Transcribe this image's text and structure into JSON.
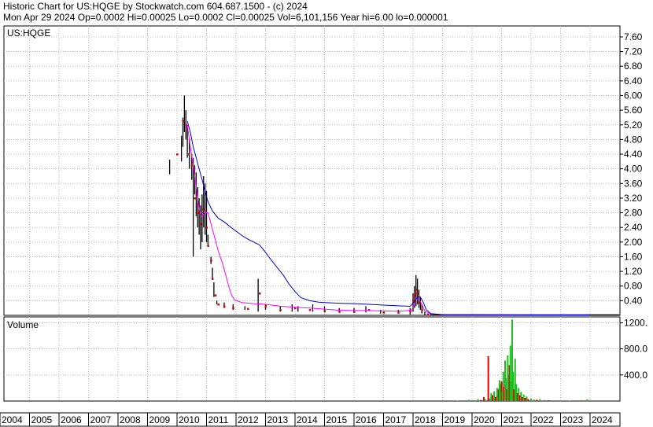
{
  "header": {
    "line1": "Historic Chart for US:HQGE by Stockwatch.com 604.687.1500 - (c) 2024",
    "line2": "Mon Apr 29 2024   Op=0.0002   Hi=0.00025   Lo=0.0002   Cl=0.00025   Vol=6,101,156   Year hi=6.00   lo=0.000001"
  },
  "chart_data": [
    {
      "type": "line",
      "title": "US:HQGE",
      "ylim": [
        0,
        7.9
      ],
      "yticks": [
        "7.60",
        "7.20",
        "6.80",
        "6.40",
        "6.00",
        "5.60",
        "5.20",
        "4.80",
        "4.40",
        "4.00",
        "3.60",
        "3.20",
        "2.80",
        "2.40",
        "2.00",
        "1.60",
        "1.20",
        "0.80",
        "0.40"
      ],
      "grid": true,
      "x_labels": [
        "2004",
        "2005",
        "2006",
        "2007",
        "2008",
        "2009",
        "2010",
        "2011",
        "2012",
        "2013",
        "2014",
        "2015",
        "2016",
        "2017",
        "2018",
        "2019",
        "2020",
        "2021",
        "2022",
        "2023",
        "2024"
      ],
      "price_range": [
        [
          2009.75,
          3.85,
          4.25
        ],
        [
          2010.15,
          4.2,
          4.9
        ],
        [
          2010.2,
          4.6,
          5.4
        ],
        [
          2010.25,
          5.0,
          6.0
        ],
        [
          2010.3,
          4.8,
          5.6
        ],
        [
          2010.35,
          4.3,
          5.2
        ],
        [
          2010.42,
          4.0,
          4.8
        ],
        [
          2010.5,
          3.7,
          4.4
        ],
        [
          2010.55,
          1.6,
          4.3
        ],
        [
          2010.6,
          3.3,
          4.1
        ],
        [
          2010.65,
          2.7,
          3.9
        ],
        [
          2010.7,
          2.4,
          3.5
        ],
        [
          2010.75,
          2.2,
          3.2
        ],
        [
          2010.8,
          1.8,
          3.0
        ],
        [
          2010.85,
          2.0,
          3.3
        ],
        [
          2010.9,
          2.4,
          3.8
        ],
        [
          2010.95,
          2.2,
          3.6
        ],
        [
          2011.0,
          2.0,
          3.4
        ],
        [
          2011.05,
          1.9,
          2.2
        ],
        [
          2011.15,
          1.4,
          1.6
        ],
        [
          2011.2,
          1.0,
          1.3
        ],
        [
          2011.25,
          0.5,
          0.9
        ],
        [
          2011.35,
          0.3,
          0.4
        ],
        [
          2011.6,
          0.2,
          0.35
        ],
        [
          2011.9,
          0.15,
          0.3
        ],
        [
          2012.3,
          0.15,
          0.25
        ],
        [
          2012.75,
          0.1,
          1.0
        ],
        [
          2013.0,
          0.15,
          0.3
        ],
        [
          2013.5,
          0.1,
          0.25
        ],
        [
          2013.9,
          0.1,
          0.3
        ],
        [
          2014.1,
          0.1,
          0.25
        ],
        [
          2014.6,
          0.1,
          0.3
        ],
        [
          2015.0,
          0.08,
          0.25
        ],
        [
          2015.5,
          0.08,
          0.2
        ],
        [
          2016.0,
          0.08,
          0.2
        ],
        [
          2016.4,
          0.08,
          0.25
        ],
        [
          2016.9,
          0.05,
          0.15
        ],
        [
          2017.5,
          0.05,
          0.15
        ],
        [
          2017.9,
          0.02,
          0.2
        ],
        [
          2018.0,
          0.1,
          0.6
        ],
        [
          2018.05,
          0.2,
          0.8
        ],
        [
          2018.1,
          0.25,
          1.1
        ],
        [
          2018.15,
          0.3,
          1.0
        ],
        [
          2018.2,
          0.2,
          0.7
        ],
        [
          2018.25,
          0.15,
          0.5
        ],
        [
          2018.3,
          0.05,
          0.3
        ],
        [
          2018.4,
          0.01,
          0.1
        ],
        [
          2018.6,
          0.005,
          0.05
        ],
        [
          2019.0,
          0.001,
          0.02
        ],
        [
          2021.0,
          0.001,
          0.01
        ],
        [
          2023.9,
          0.0002,
          0.001
        ]
      ],
      "close_points": [
        [
          2010.0,
          4.4
        ],
        [
          2010.2,
          5.3
        ],
        [
          2010.3,
          5.2
        ],
        [
          2010.4,
          4.4
        ],
        [
          2010.5,
          4.1
        ],
        [
          2010.6,
          3.2
        ],
        [
          2010.7,
          2.8
        ],
        [
          2010.8,
          2.5
        ],
        [
          2010.9,
          2.9
        ],
        [
          2011.0,
          2.4
        ],
        [
          2011.05,
          1.9
        ],
        [
          2011.15,
          1.5
        ],
        [
          2011.2,
          1.0
        ],
        [
          2011.3,
          0.55
        ],
        [
          2011.4,
          0.3
        ],
        [
          2011.6,
          0.25
        ],
        [
          2011.9,
          0.2
        ],
        [
          2012.4,
          0.18
        ],
        [
          2012.8,
          0.6
        ],
        [
          2013.0,
          0.25
        ],
        [
          2013.5,
          0.15
        ],
        [
          2014.0,
          0.2
        ],
        [
          2014.5,
          0.15
        ],
        [
          2015.0,
          0.12
        ],
        [
          2015.5,
          0.1
        ],
        [
          2016.0,
          0.1
        ],
        [
          2016.5,
          0.15
        ],
        [
          2017.0,
          0.08
        ],
        [
          2017.5,
          0.08
        ],
        [
          2017.9,
          0.12
        ],
        [
          2018.0,
          0.4
        ],
        [
          2018.05,
          0.55
        ],
        [
          2018.1,
          0.7
        ],
        [
          2018.15,
          0.6
        ],
        [
          2018.2,
          0.35
        ],
        [
          2018.3,
          0.15
        ],
        [
          2018.5,
          0.03
        ]
      ],
      "series": [
        {
          "color": "#ff00ff",
          "points": [
            [
              2010.35,
              5.2
            ],
            [
              2010.45,
              4.6
            ],
            [
              2010.55,
              4.1
            ],
            [
              2010.65,
              3.5
            ],
            [
              2010.75,
              2.9
            ],
            [
              2010.85,
              2.7
            ],
            [
              2010.95,
              2.8
            ],
            [
              2011.05,
              2.8
            ],
            [
              2011.15,
              2.5
            ],
            [
              2011.25,
              2.2
            ],
            [
              2011.4,
              1.75
            ],
            [
              2011.55,
              1.4
            ],
            [
              2011.65,
              1.1
            ],
            [
              2011.75,
              0.8
            ],
            [
              2011.85,
              0.55
            ],
            [
              2011.95,
              0.42
            ],
            [
              2012.2,
              0.35
            ],
            [
              2012.6,
              0.32
            ],
            [
              2013.0,
              0.3
            ],
            [
              2013.5,
              0.25
            ],
            [
              2014.0,
              0.22
            ],
            [
              2014.5,
              0.2
            ],
            [
              2015.0,
              0.17
            ],
            [
              2015.5,
              0.14
            ],
            [
              2016.0,
              0.13
            ],
            [
              2016.5,
              0.13
            ],
            [
              2017.0,
              0.12
            ],
            [
              2017.5,
              0.11
            ],
            [
              2017.95,
              0.14
            ],
            [
              2018.05,
              0.3
            ],
            [
              2018.12,
              0.5
            ],
            [
              2018.2,
              0.45
            ],
            [
              2018.3,
              0.3
            ],
            [
              2018.4,
              0.12
            ],
            [
              2018.6,
              0.04
            ],
            [
              2019.0,
              0.02
            ],
            [
              2020.0,
              0.015
            ],
            [
              2022.0,
              0.01
            ],
            [
              2024.0,
              0.01
            ]
          ]
        },
        {
          "color": "#0000cc",
          "points": [
            [
              2010.35,
              5.3
            ],
            [
              2010.45,
              5.0
            ],
            [
              2010.55,
              4.6
            ],
            [
              2010.65,
              4.3
            ],
            [
              2010.75,
              4.0
            ],
            [
              2010.85,
              3.7
            ],
            [
              2010.95,
              3.4
            ],
            [
              2011.05,
              3.1
            ],
            [
              2011.2,
              2.85
            ],
            [
              2011.4,
              2.65
            ],
            [
              2011.6,
              2.55
            ],
            [
              2011.8,
              2.42
            ],
            [
              2012.0,
              2.3
            ],
            [
              2012.2,
              2.18
            ],
            [
              2012.4,
              2.08
            ],
            [
              2012.6,
              2.0
            ],
            [
              2012.8,
              1.92
            ],
            [
              2013.0,
              1.72
            ],
            [
              2013.2,
              1.5
            ],
            [
              2013.4,
              1.3
            ],
            [
              2013.6,
              1.1
            ],
            [
              2013.8,
              0.85
            ],
            [
              2014.0,
              0.65
            ],
            [
              2014.2,
              0.48
            ],
            [
              2014.5,
              0.4
            ],
            [
              2014.8,
              0.36
            ],
            [
              2015.0,
              0.35
            ],
            [
              2015.5,
              0.33
            ],
            [
              2016.0,
              0.32
            ],
            [
              2016.5,
              0.3
            ],
            [
              2017.0,
              0.28
            ],
            [
              2017.5,
              0.26
            ],
            [
              2017.9,
              0.25
            ],
            [
              2018.05,
              0.38
            ],
            [
              2018.15,
              0.5
            ],
            [
              2018.25,
              0.5
            ],
            [
              2018.35,
              0.35
            ],
            [
              2018.45,
              0.15
            ],
            [
              2018.6,
              0.05
            ],
            [
              2019.0,
              0.02
            ],
            [
              2020.0,
              0.015
            ],
            [
              2021.0,
              0.012
            ],
            [
              2022.0,
              0.01
            ],
            [
              2024.0,
              0.01
            ]
          ]
        }
      ]
    },
    {
      "type": "bar",
      "title": "Volume",
      "ylim": [
        0,
        1290
      ],
      "yticks": [
        "1200.",
        "800.0",
        "400.0"
      ],
      "grid": true,
      "bars": [
        [
          2019.5,
          8,
          "green"
        ],
        [
          2019.9,
          20,
          "green"
        ],
        [
          2020.05,
          12,
          "green"
        ],
        [
          2020.2,
          30,
          "green"
        ],
        [
          2020.3,
          18,
          "red"
        ],
        [
          2020.4,
          60,
          "red"
        ],
        [
          2020.45,
          25,
          "green"
        ],
        [
          2020.55,
          690,
          "red"
        ],
        [
          2020.6,
          40,
          "green"
        ],
        [
          2020.65,
          120,
          "green"
        ],
        [
          2020.7,
          90,
          "red"
        ],
        [
          2020.75,
          150,
          "green"
        ],
        [
          2020.8,
          60,
          "red"
        ],
        [
          2020.85,
          200,
          "green"
        ],
        [
          2020.9,
          180,
          "red"
        ],
        [
          2020.93,
          320,
          "green"
        ],
        [
          2020.97,
          260,
          "green"
        ],
        [
          2021.0,
          300,
          "red"
        ],
        [
          2021.03,
          150,
          "green"
        ],
        [
          2021.06,
          450,
          "green"
        ],
        [
          2021.09,
          220,
          "red"
        ],
        [
          2021.12,
          620,
          "green"
        ],
        [
          2021.15,
          350,
          "green"
        ],
        [
          2021.18,
          180,
          "red"
        ],
        [
          2021.21,
          700,
          "green"
        ],
        [
          2021.24,
          400,
          "green"
        ],
        [
          2021.27,
          550,
          "red"
        ],
        [
          2021.3,
          850,
          "green"
        ],
        [
          2021.33,
          300,
          "green"
        ],
        [
          2021.36,
          1250,
          "green"
        ],
        [
          2021.39,
          450,
          "green"
        ],
        [
          2021.42,
          180,
          "red"
        ],
        [
          2021.46,
          650,
          "green"
        ],
        [
          2021.5,
          260,
          "green"
        ],
        [
          2021.54,
          120,
          "red"
        ],
        [
          2021.58,
          200,
          "green"
        ],
        [
          2021.62,
          90,
          "red"
        ],
        [
          2021.66,
          140,
          "green"
        ],
        [
          2021.7,
          60,
          "red"
        ],
        [
          2021.75,
          100,
          "green"
        ],
        [
          2021.8,
          50,
          "red"
        ],
        [
          2021.85,
          70,
          "green"
        ],
        [
          2021.9,
          30,
          "red"
        ],
        [
          2022.0,
          40,
          "green"
        ],
        [
          2022.1,
          25,
          "green"
        ],
        [
          2022.2,
          20,
          "red"
        ],
        [
          2022.3,
          30,
          "green"
        ],
        [
          2022.45,
          15,
          "green"
        ],
        [
          2022.6,
          12,
          "red"
        ],
        [
          2023.0,
          10,
          "green"
        ],
        [
          2023.3,
          8,
          "green"
        ],
        [
          2023.7,
          15,
          "green"
        ],
        [
          2023.9,
          25,
          "green"
        ]
      ]
    }
  ]
}
